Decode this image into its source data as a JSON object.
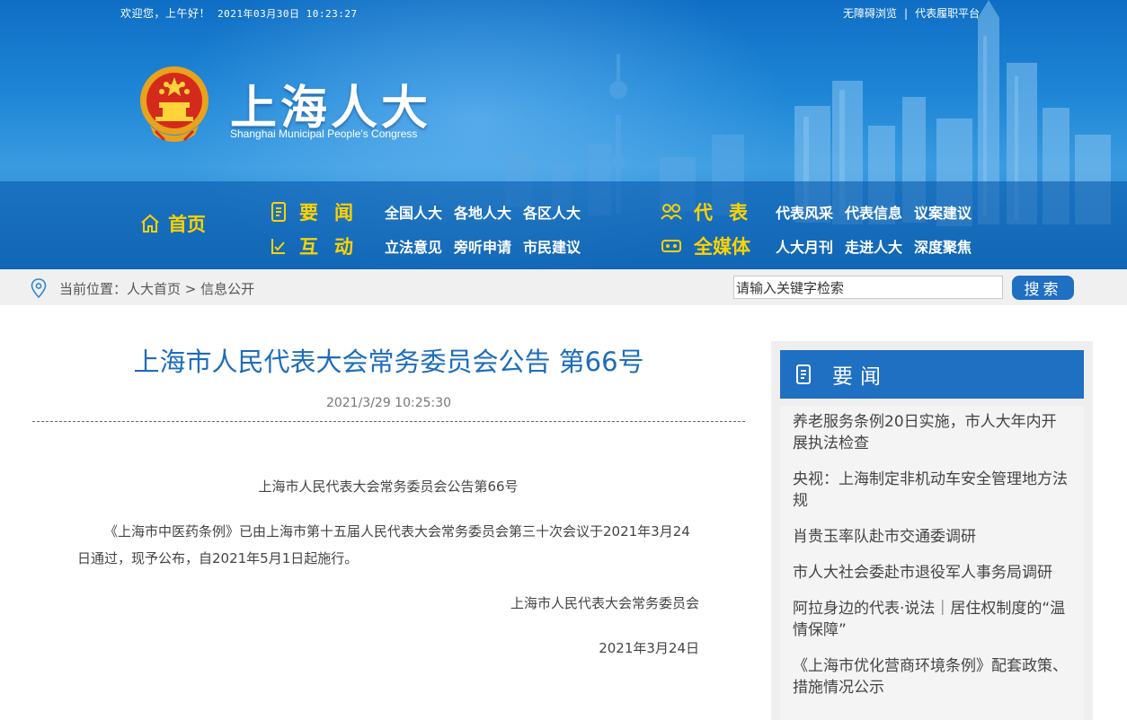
{
  "topbar": {
    "greeting": "欢迎您，上午好！",
    "datetime": "2021年03月30日 10:23:27",
    "links": [
      "无障碍浏览",
      "代表履职平台"
    ],
    "separator": "|"
  },
  "logo": {
    "title_cn": "上海人大",
    "title_en": "Shanghai Municipal People's Congress",
    "emblem_icon": "national-emblem-icon"
  },
  "nav": {
    "home": "首页",
    "categories": [
      {
        "label": "要闻",
        "icon": "news-icon",
        "links": [
          "全国人大",
          "各地人大",
          "各区人大"
        ]
      },
      {
        "label": "互动",
        "icon": "check-hand-icon",
        "links": [
          "立法意见",
          "旁听申请",
          "市民建议"
        ]
      },
      {
        "label": "代表",
        "icon": "people-icon",
        "links": [
          "代表风采",
          "代表信息",
          "议案建议"
        ]
      },
      {
        "label": "全媒体",
        "icon": "media-icon",
        "links": [
          "人大月刊",
          "走进人大",
          "深度聚焦"
        ]
      }
    ]
  },
  "breadcrumb": {
    "prefix": "当前位置：",
    "items": [
      "人大首页",
      "信息公开"
    ],
    "separator": " > "
  },
  "search": {
    "value": "请输入关键字检索",
    "button": "搜索"
  },
  "article": {
    "title": "上海市人民代表大会常务委员会公告 第66号",
    "date": "2021/3/29 10:25:30",
    "heading": "上海市人民代表大会常务委员会公告第66号",
    "body": "《上海市中医药条例》已由上海市第十五届人民代表大会常务委员会第三十次会议于2021年3月24日通过，现予公布，自2021年5月1日起施行。",
    "issuer": "上海市人民代表大会常务委员会",
    "issue_date": "2021年3月24日"
  },
  "sidebar": {
    "title": "要闻",
    "items": [
      "养老服务条例20日实施，市人大年内开展执法检查",
      "央视：上海制定非机动车安全管理地方法规",
      "肖贵玉率队赴市交通委调研",
      "市人大社会委赴市退役军人事务局调研",
      "阿拉身边的代表·说法｜居住权制度的“温情保障”",
      "《上海市优化营商环境条例》配套政策、措施情况公示"
    ]
  },
  "colors": {
    "banner": "#1e86d6",
    "nav_highlight": "#ffd200",
    "title_blue": "#1d6cbc",
    "button_blue": "#1f6fc3"
  }
}
